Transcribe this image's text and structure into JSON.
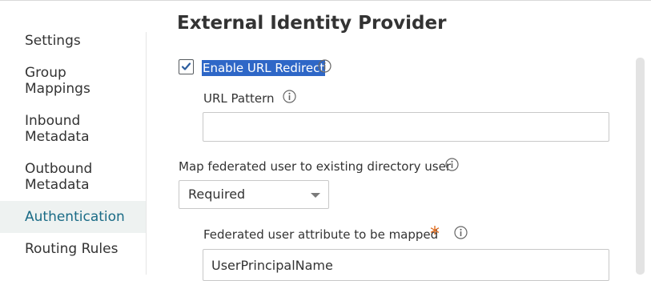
{
  "sidebar": {
    "items": [
      {
        "label": "Settings"
      },
      {
        "label": "Group Mappings",
        "lines": [
          "Group",
          "Mappings"
        ]
      },
      {
        "label": "Inbound Metadata",
        "lines": [
          "Inbound",
          "Metadata"
        ]
      },
      {
        "label": "Outbound Metadata",
        "lines": [
          "Outbound",
          "Metadata"
        ]
      },
      {
        "label": "Authentication",
        "active": true
      },
      {
        "label": "Routing Rules"
      }
    ]
  },
  "main": {
    "title": "External Identity Provider",
    "enable_redirect": {
      "label": "Enable URL Redirect",
      "checked": true
    },
    "url_pattern": {
      "label": "URL Pattern",
      "value": ""
    },
    "map_user": {
      "label": "Map federated user to existing directory user",
      "selected": "Required"
    },
    "attribute": {
      "label": "Federated user attribute to be mapped",
      "required_mark": "*",
      "value": "UserPrincipalName"
    }
  },
  "colors": {
    "accent": "#1a6b86",
    "selection": "#2e67c7",
    "required": "#e06a1b",
    "active_bg": "#eef2f1"
  },
  "icons": {
    "info": "info-icon",
    "check": "check-icon",
    "dropdown": "chevron-down-icon"
  }
}
